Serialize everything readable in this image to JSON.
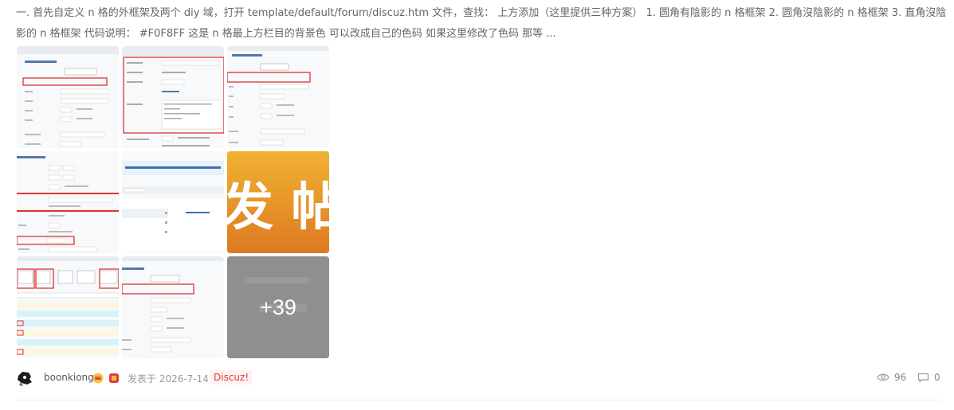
{
  "post": {
    "excerpt": "一. 首先自定义 n 格的外框架及两个 diy 域，打开 template/default/forum/discuz.htm 文件，查找： 上方添加（这里提供三种方案） 1. 圆角有陰影的 n 格框架 2. 圆角沒陰影的 n 格框架 3. 直角沒陰影的 n 格框架 代码说明： #F0F8FF 这是 n 格最上方栏目的背景色 可以改成自己的色码 如果这里修改了色码 那等 ..."
  },
  "gallery": {
    "more_label": "+39",
    "highlight_text": "发 帖"
  },
  "meta": {
    "author": "boonkiong",
    "posted": "发表于 2026-7-14",
    "forum": "Discuz!",
    "views": "96",
    "replies": "0"
  },
  "colors": {
    "accent_red": "#e4393c",
    "orange": "#e8962a",
    "divider": "#ececec"
  }
}
